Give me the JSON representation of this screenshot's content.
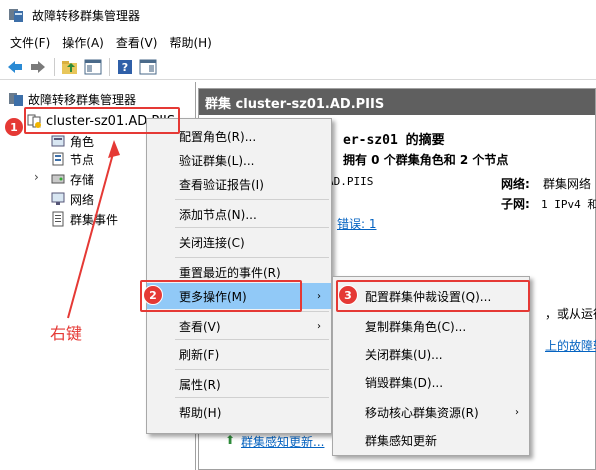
{
  "window": {
    "title": "故障转移群集管理器"
  },
  "menubar": [
    "文件(F)",
    "操作(A)",
    "查看(V)",
    "帮助(H)"
  ],
  "tree": {
    "root": "故障转移群集管理器",
    "cluster": "cluster-sz01.AD.PIIS",
    "children": [
      "角色",
      "节点",
      "存储",
      "网络",
      "群集事件"
    ]
  },
  "pane": {
    "header": "群集 cluster-sz01.AD.PIIS",
    "summary_title": "er-sz01 的摘要",
    "summary_line": "拥有 0 个群集角色和 2 个节点",
    "domain_frag": "AD.PIIS",
    "network_label": "网络:",
    "network_value": "群集网络",
    "subnet_label": "子网:",
    "subnet_value": "1 IPv4 和",
    "errors_link": "错误: 1",
    "frag_text": "，或从运行",
    "frag_link": "上的故障转",
    "bottom_link": "群集感知更新..."
  },
  "context_menu": {
    "items": [
      "配置角色(R)...",
      "验证群集(L)...",
      "查看验证报告(I)",
      "添加节点(N)...",
      "关闭连接(C)",
      "重置最近的事件(R)",
      "更多操作(M)",
      "查看(V)",
      "刷新(F)",
      "属性(R)",
      "帮助(H)"
    ]
  },
  "submenu": {
    "items": [
      "配置群集仲裁设置(Q)...",
      "复制群集角色(C)...",
      "关闭群集(U)...",
      "销毁群集(D)...",
      "移动核心群集资源(R)",
      "群集感知更新"
    ]
  },
  "annotations": {
    "badge1": "1",
    "badge2": "2",
    "badge3": "3",
    "right_click": "右键"
  }
}
